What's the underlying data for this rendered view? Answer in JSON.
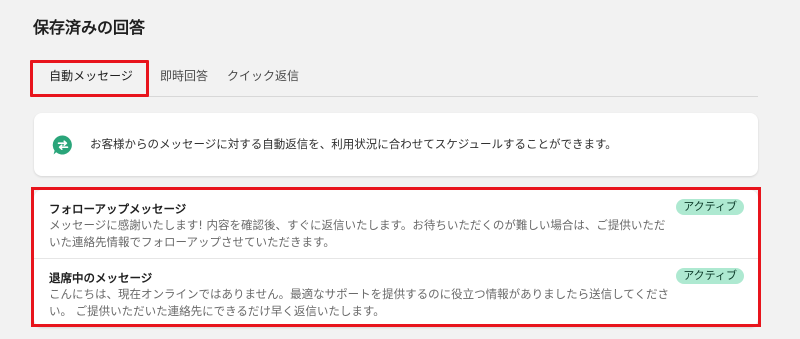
{
  "page": {
    "title": "保存済みの回答"
  },
  "tabs": [
    {
      "label": "自動メッセージ",
      "active": true
    },
    {
      "label": "即時回答",
      "active": false
    },
    {
      "label": "クイック返信",
      "active": false
    }
  ],
  "info": {
    "icon": "chat-bubble-arrows-icon",
    "text": "お客様からのメッセージに対する自動返信を、利用状況に合わせてスケジュールすることができます。"
  },
  "messages": [
    {
      "title": "フォローアップメッセージ",
      "body": "メッセージに感謝いたします! 内容を確認後、すぐに返信いたします。お待ちいただくのが難しい場合は、ご提供いただいた連絡先情報でフォローアップさせていただきます。",
      "status": "アクティブ"
    },
    {
      "title": "退席中のメッセージ",
      "body": "こんにちは、現在オンラインではありません。最適なサポートを提供するのに役立つ情報がありましたら送信してください。 ご提供いただいた連絡先にできるだけ早く返信いたします。",
      "status": "アクティブ"
    }
  ],
  "colors": {
    "accent": "#1f8a5b",
    "badge_bg": "#aee9d1",
    "highlight": "#e8141c",
    "icon": "#2aa57a"
  }
}
